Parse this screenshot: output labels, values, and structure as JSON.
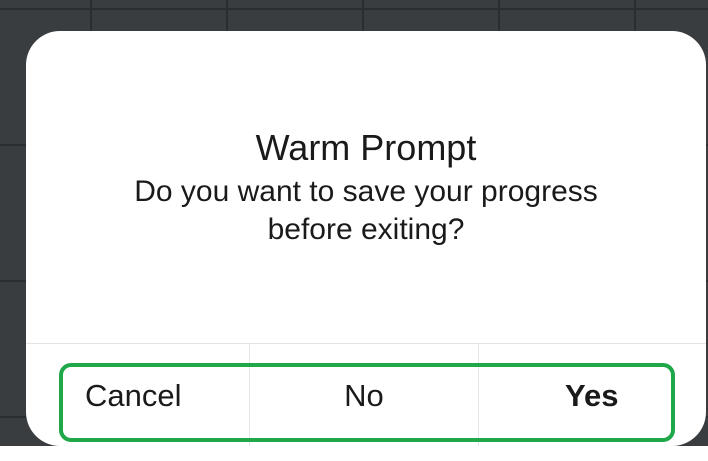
{
  "dialog": {
    "title": "Warm Prompt",
    "message_line1": "Do you want to save your progress",
    "message_line2": "before exiting?",
    "buttons": {
      "cancel": "Cancel",
      "no": "No",
      "yes": "Yes"
    }
  },
  "colors": {
    "highlight": "#1ea84a",
    "backdrop": "#3a3d40",
    "text": "#1a1a1a"
  }
}
